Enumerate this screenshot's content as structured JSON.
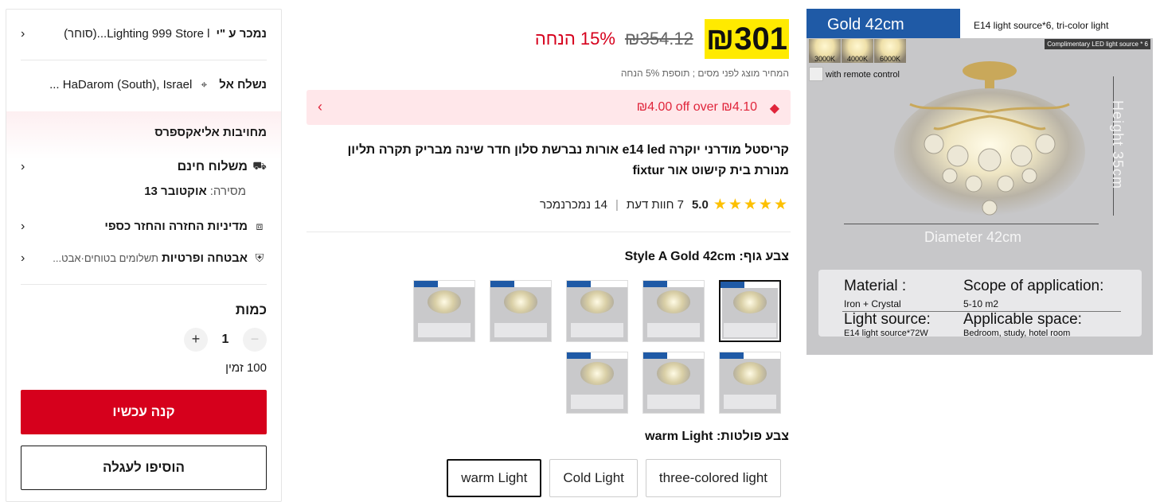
{
  "seller": {
    "label": "נמכר ע \"י",
    "name": "Lighting 999 Store l...(סוחר)"
  },
  "ship_to": {
    "label": "נשלח אל",
    "location": "HaDarom (South), Israel ..."
  },
  "commitments": {
    "heading": "מחויבות אליאקספרס",
    "free_shipping": "משלוח חינם",
    "delivery_label": "מסירה:",
    "delivery_date": "אוקטובר 13",
    "returns": "מדיניות החזרה והחזר כספי",
    "security": "אבטחה ופרטיות",
    "security_sub": "תשלומים בטוחים·אבט..."
  },
  "quantity": {
    "label": "כמות",
    "value": "1",
    "minus": "−",
    "plus": "+",
    "available": "100 זמין"
  },
  "buttons": {
    "buy_now": "קנה עכשיו",
    "add_to_cart": "הוסיפו לעגלה"
  },
  "price": {
    "current": "₪301",
    "original": "₪354.12",
    "discount": "15% הנחה",
    "tax_note": "המחיר מוצג לפני מסים ; תוספת 5% הנחה"
  },
  "coupon": {
    "text": "₪4.00 off over ₪4.10"
  },
  "product": {
    "title": "קריסטל מודרני יוקרה e14 led אורות נברשת סלון חדר שינה מבריק תקרה תליון מנורת בית קישוט אור fixtur",
    "rating": "5.0",
    "stars": "★★★★★",
    "reviews": "7 חוות דעת",
    "sold": "14 נמכרנמכר"
  },
  "body_color": {
    "label": "צבע גוף: Style A Gold 42cm",
    "thumbnail_count": 8,
    "selected_index": 0
  },
  "light_color": {
    "label": "צבע פולטות: warm Light",
    "options": [
      "three-colored light",
      "Cold Light",
      "warm Light"
    ],
    "selected": "warm Light"
  },
  "hero_image": {
    "size_tag": "Gold 42cm",
    "light_source_caption": "E14 light source*6, tri-color light",
    "complimentary": "Complimentary LED light source * 6",
    "temps": [
      "3000K",
      "4000K",
      "6000K"
    ],
    "remote": "with remote control",
    "height": "Height 35cm",
    "diameter": "Diameter 42cm",
    "spec": {
      "material_label": "Material :",
      "material_value": "Iron + Crystal",
      "scope_label": "Scope of application:",
      "scope_value": "5-10 m2",
      "light_label": "Light source:",
      "light_value": "E14 light source*72W",
      "space_label": "Applicable space:",
      "space_value": "Bedroom, study, hotel room"
    }
  },
  "colors": {
    "accent_red": "#d6001c",
    "price_highlight": "#ffea00",
    "star": "#fdc000",
    "coupon_bg": "#ffe7ea",
    "hero_tag_blue": "#1f5aa6"
  }
}
